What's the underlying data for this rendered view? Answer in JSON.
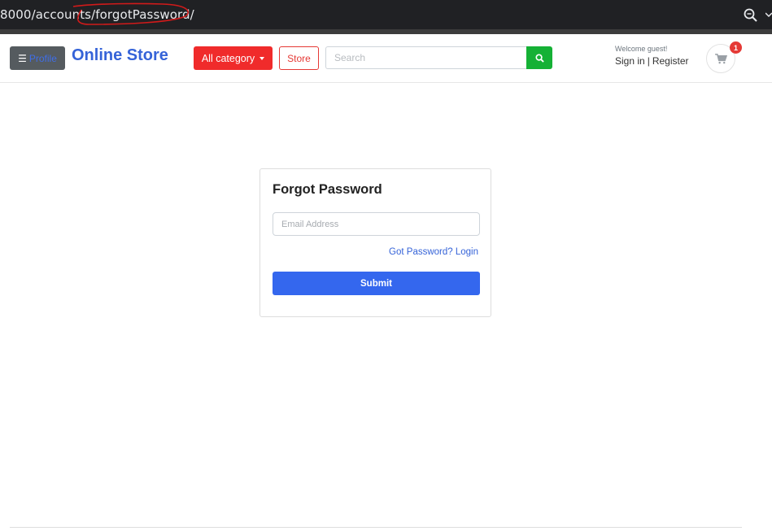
{
  "browser": {
    "url": "8000/accounts/forgotPassword/",
    "icons": [
      "zoom-icon",
      "chevron-down-icon"
    ],
    "annotation_color": "#d11a1a"
  },
  "header": {
    "profile_label": "Profile",
    "brand": "Online Store",
    "category_label": "All category",
    "store_label": "Store",
    "search_placeholder": "Search",
    "welcome": "Welcome guest!",
    "signin": "Sign in",
    "register": "Register",
    "cart_count": "1"
  },
  "form": {
    "title": "Forgot Password",
    "email_placeholder": "Email Address",
    "login_link": "Got Password? Login",
    "submit_label": "Submit"
  },
  "colors": {
    "brand": "#3563d8",
    "danger": "#f02b2b",
    "success": "#15b135",
    "primary": "#3467ee"
  }
}
